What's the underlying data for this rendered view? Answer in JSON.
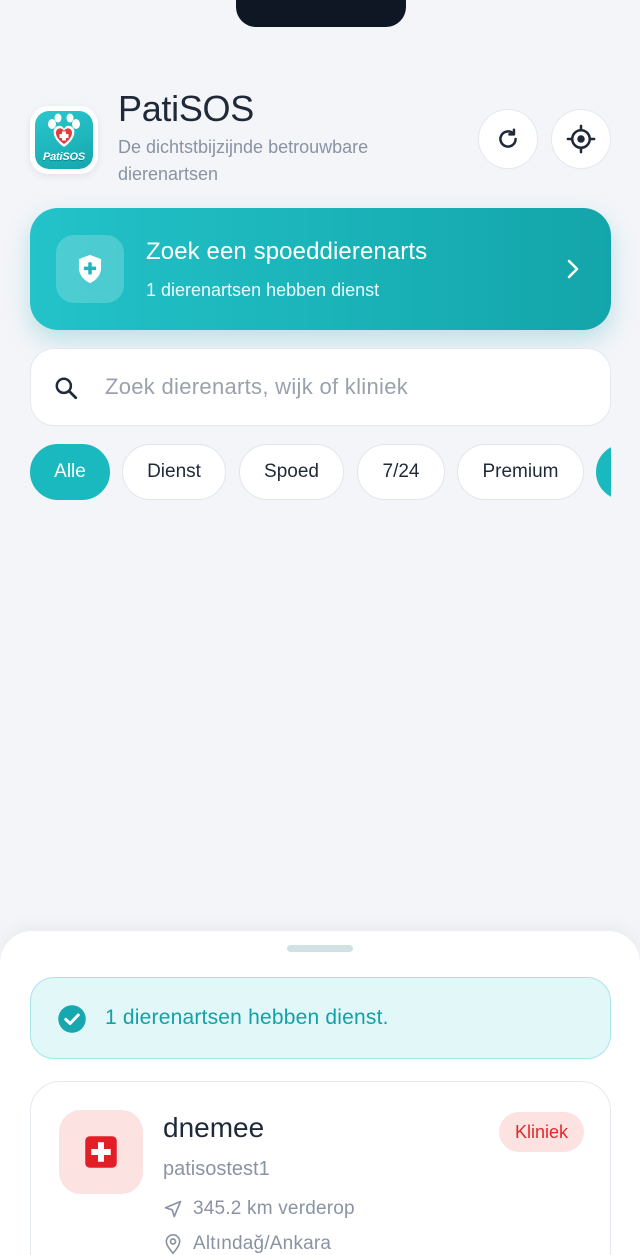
{
  "app": {
    "title": "PatiSOS",
    "subtitle": "De dichtstbijzijnde betrouwbare dierenartsen",
    "logo_text": "PatiSOS"
  },
  "header_actions": {
    "refresh_icon": "refresh-icon",
    "locate_icon": "crosshair-location-icon"
  },
  "emergency": {
    "title": "Zoek een spoeddierenarts",
    "subtitle": "1 dierenartsen hebben dienst",
    "icon": "shield-plus-icon"
  },
  "search": {
    "placeholder": "Zoek dierenarts, wijk of kliniek",
    "value": ""
  },
  "filters": {
    "selected": "Alle",
    "chips": [
      "Alle",
      "Dienst",
      "Spoed",
      "7/24",
      "Premium"
    ]
  },
  "sheet": {
    "duty_message": "1 dierenartsen hebben dienst."
  },
  "clinic": {
    "name": "dnemee",
    "subtitle": "patisostest1",
    "badge": "Kliniek",
    "distance": "345.2 km verderop",
    "location": "Altındağ/Ankara"
  },
  "colors": {
    "accent": "#1ab9bf",
    "accent_dark": "#13a5aa",
    "badge_red": "#e0282a",
    "badge_red_bg": "#fde2e2",
    "background": "#f3f5f9"
  }
}
